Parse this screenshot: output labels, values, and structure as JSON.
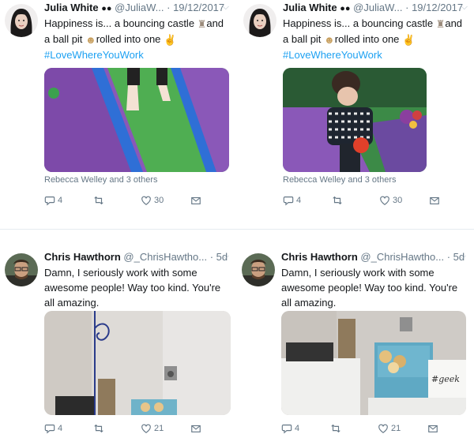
{
  "tweets": [
    {
      "name": "Julia White",
      "handle": "@JuliaW...",
      "date": "· 19/12/2017",
      "line1": "Happiness is... a bouncing castle",
      "line1_after": "and",
      "line2": "a ball pit",
      "line2_after": "rolled into one",
      "hashtag": "#LoveWhereYouWork",
      "social": "Rebecca Welley and 3 others",
      "replies": "4",
      "likes": "30"
    },
    {
      "name": "Julia White",
      "handle": "@JuliaW...",
      "date": "· 19/12/2017",
      "line1": "Happiness is... a bouncing castle",
      "line1_after": "and",
      "line2": "a ball pit",
      "line2_after": "rolled into one",
      "hashtag": "#LoveWhereYouWork",
      "social": "Rebecca Welley and 3 others",
      "replies": "4",
      "likes": "30"
    },
    {
      "name": "Chris Hawthorn",
      "handle": "@_ChrisHawtho...",
      "date": "· 5d",
      "line1": "Damn, I seriously work with some",
      "line2": "awesome people! Way too kind. You're",
      "line3": "all amazing.",
      "replies": "4",
      "likes": "21"
    },
    {
      "name": "Chris Hawthorn",
      "handle": "@_ChrisHawtho...",
      "date": "· 5d",
      "line1": "Damn, I seriously work with some",
      "line2": "awesome people! Way too kind. You're",
      "line3": "all amazing.",
      "replies": "4",
      "likes": "21",
      "sign_text": "#geek"
    }
  ],
  "colors": {
    "accent": "#1da1f2",
    "muted": "#657786",
    "divider": "#e6ecf0"
  },
  "icons": [
    "reply-icon",
    "retweet-icon",
    "like-icon",
    "dm-icon",
    "chevron-down-icon",
    "eyes-emoji",
    "castle-emoji",
    "baby-emoji",
    "ok-hand-emoji"
  ]
}
